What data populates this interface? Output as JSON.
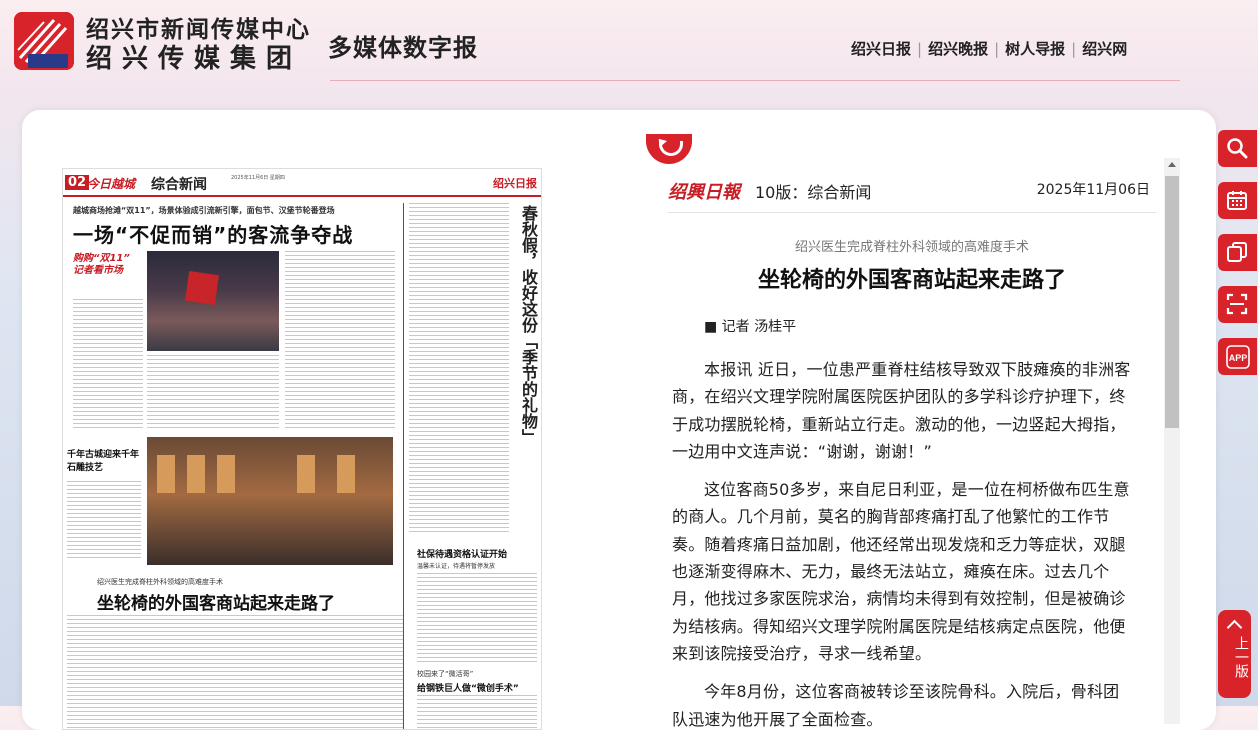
{
  "header": {
    "org_line1": "绍兴市新闻传媒中心",
    "org_line2": "绍兴传媒集团",
    "product_title": "多媒体数字报",
    "nav": [
      "绍兴日报",
      "绍兴晚报",
      "树人导报",
      "绍兴网"
    ],
    "nav_separator": "|"
  },
  "page_thumb": {
    "page_number": "02",
    "section_tag": "今日越城",
    "section_name": "综合新闻",
    "masthead": "绍兴日报",
    "editor_line": "2025年11月6日 星期四",
    "story1_kicker": "越城商场抢滩“双11”，场景体验成引流新引擎，面包节、汉堡节轮番登场",
    "story1_headline": "一场“不促而销”的客流争夺战",
    "story1_badge": "购购“双11” 记者看市场",
    "story2_headline": "千年古城迎来千年石雕技艺",
    "story3_kicker": "绍兴医生完成脊柱外科领域的高难度手术",
    "story3_headline": "坐轮椅的外国客商站起来走路了",
    "side_headline": "春秋假，收好这份「季节的礼物」",
    "story4_headline": "社保待遇资格认证开始",
    "story4_sub": "温馨未认证，待遇将暂停发放",
    "story5_kicker": "校园来了“微活哥”",
    "story5_headline": "给钢铁巨人做“微创手术”"
  },
  "article": {
    "brand": "绍興日報",
    "edition": "10版：综合新闻",
    "date": "2025年11月06日",
    "subtitle": "绍兴医生完成脊柱外科领域的高难度手术",
    "title": "坐轮椅的外国客商站起来走路了",
    "author": "■ 记者 汤桂平",
    "paragraphs": [
      "本报讯 近日，一位患严重脊柱结核导致双下肢瘫痪的非洲客商，在绍兴文理学院附属医院医护团队的多学科诊疗护理下，终于成功摆脱轮椅，重新站立行走。激动的他，一边竖起大拇指，一边用中文连声说：“谢谢，谢谢！”",
      "这位客商50多岁，来自尼日利亚，是一位在柯桥做布匹生意的商人。几个月前，莫名的胸背部疼痛打乱了他繁忙的工作节奏。随着疼痛日益加剧，他还经常出现发烧和乏力等症状，双腿也逐渐变得麻木、无力，最终无法站立，瘫痪在床。过去几个月，他找过多家医院求治，病情均未得到有效控制，但是被确诊为结核病。得知绍兴文理学院附属医院是结核病定点医院，他便来到该院接受治疗，寻求一线希望。",
      "今年8月份，这位客商被转诊至该院骨科。入院后，骨科团队迅速为他开展了全面检查。"
    ]
  },
  "toolbar": {
    "items": [
      "search-icon",
      "calendar-icon",
      "copy-icon",
      "scan-icon",
      "app-icon"
    ],
    "app_label": "APP",
    "top_label": "上一版"
  },
  "colors": {
    "brand_red": "#d8232a",
    "dark_text": "#222222"
  }
}
